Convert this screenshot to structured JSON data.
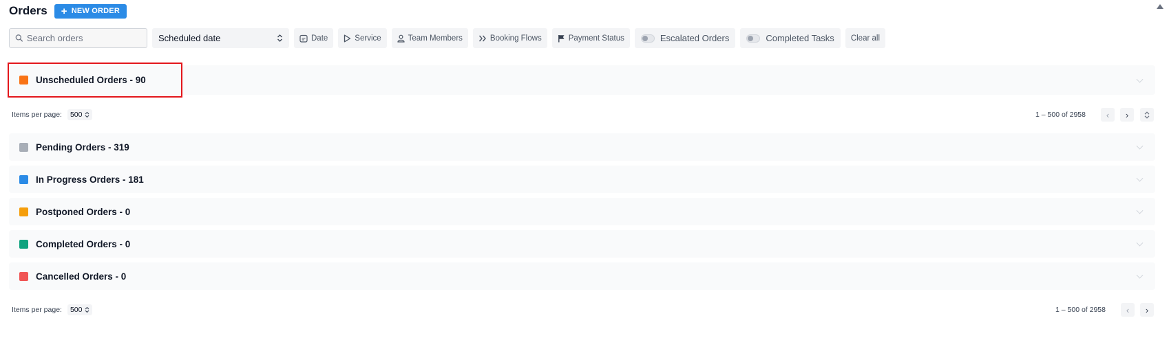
{
  "header": {
    "title": "Orders",
    "new_order_label": "NEW ORDER",
    "new_order_icon": "plus-icon"
  },
  "filters": {
    "search_placeholder": "Search orders",
    "sort_select_value": "Scheduled date",
    "date_label": "Date",
    "service_label": "Service",
    "team_members_label": "Team Members",
    "booking_flows_label": "Booking Flows",
    "payment_status_label": "Payment Status",
    "escalated_orders_label": "Escalated Orders",
    "completed_tasks_label": "Completed Tasks",
    "clear_all_label": "Clear all"
  },
  "sections": [
    {
      "label": "Unscheduled Orders - 90",
      "color": "#f97316"
    },
    {
      "label": "Pending Orders - 319",
      "color": "#a8aeb7"
    },
    {
      "label": "In Progress Orders - 181",
      "color": "#2b8be6"
    },
    {
      "label": "Postponed Orders - 0",
      "color": "#f59e0b"
    },
    {
      "label": "Completed Orders - 0",
      "color": "#10a37f"
    },
    {
      "label": "Cancelled Orders - 0",
      "color": "#f05454"
    }
  ],
  "pager_top": {
    "items_per_page_label": "Items per page:",
    "items_per_page_value": "500",
    "range_label": "1 – 500 of 2958"
  },
  "pager_bottom": {
    "items_per_page_label": "Items per page:",
    "items_per_page_value": "500",
    "range_label": "1 – 500 of 2958"
  }
}
